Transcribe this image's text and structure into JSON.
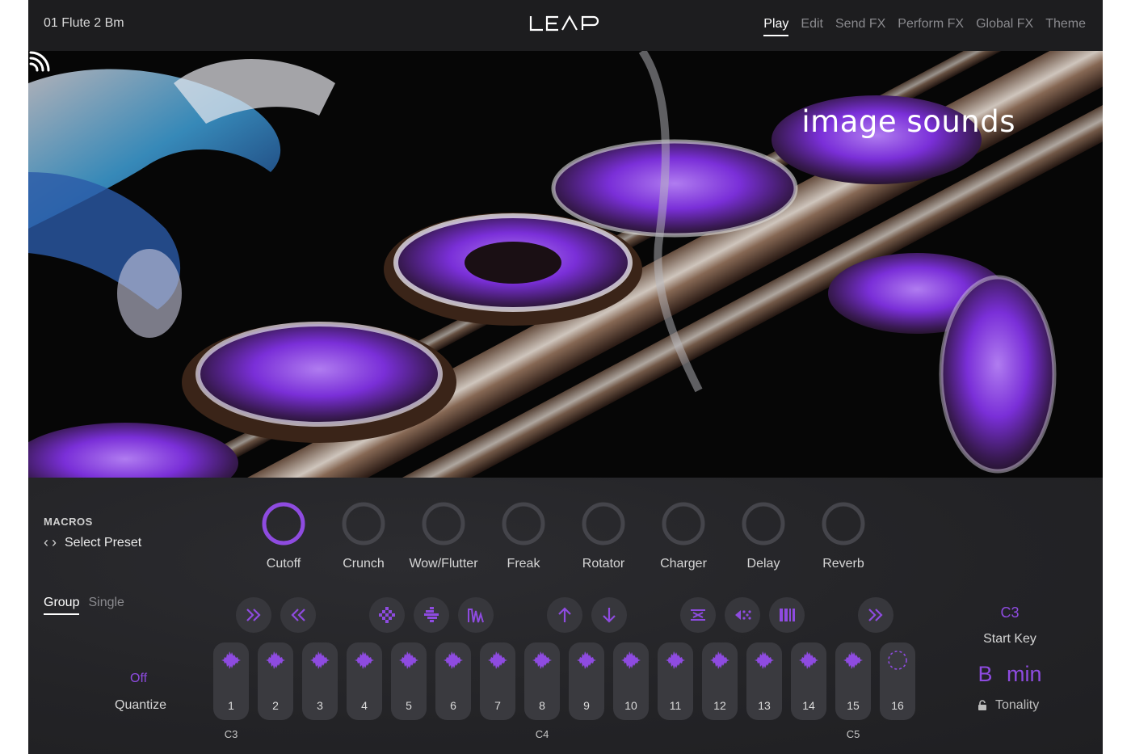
{
  "header": {
    "preset_name": "01 Flute 2 Bm",
    "logo": "LEAP",
    "tabs": [
      {
        "label": "Play",
        "active": true
      },
      {
        "label": "Edit",
        "active": false
      },
      {
        "label": "Send FX",
        "active": false
      },
      {
        "label": "Perform FX",
        "active": false
      },
      {
        "label": "Global FX",
        "active": false
      },
      {
        "label": "Theme",
        "active": false
      }
    ]
  },
  "hero": {
    "brand": "image sounds",
    "image_description_icon": "flute-artwork-image"
  },
  "macros": {
    "title": "MACROS",
    "preset_label": "Select Preset",
    "knobs": [
      {
        "label": "Cutoff",
        "value": 1.0
      },
      {
        "label": "Crunch",
        "value": 0.0
      },
      {
        "label": "Wow/Flutter",
        "value": 0.0
      },
      {
        "label": "Freak",
        "value": 0.0
      },
      {
        "label": "Rotator",
        "value": 0.0
      },
      {
        "label": "Charger",
        "value": 0.0
      },
      {
        "label": "Delay",
        "value": 0.0
      },
      {
        "label": "Reverb",
        "value": 0.0
      }
    ]
  },
  "mode_tabs": [
    {
      "label": "Group",
      "active": true
    },
    {
      "label": "Single",
      "active": false
    }
  ],
  "quantize": {
    "value": "Off",
    "label": "Quantize"
  },
  "fx_buttons": [
    {
      "icon": "fast-forward-icon"
    },
    {
      "icon": "rewind-icon"
    },
    {
      "icon": "stutter-icon"
    },
    {
      "icon": "glitch-icon"
    },
    {
      "icon": "envelope-icon"
    },
    {
      "icon": "pitch-up-icon"
    },
    {
      "icon": "pitch-down-icon"
    },
    {
      "icon": "reverse-icon"
    },
    {
      "icon": "scatter-icon"
    },
    {
      "icon": "slice-icon"
    },
    {
      "icon": "fast-forward-icon"
    }
  ],
  "pads": [
    "1",
    "2",
    "3",
    "4",
    "5",
    "6",
    "7",
    "8",
    "9",
    "10",
    "11",
    "12",
    "13",
    "14",
    "15",
    "16"
  ],
  "note_labels": [
    "C3",
    "C4",
    "C5"
  ],
  "start_key": {
    "value": "C3",
    "label": "Start Key"
  },
  "tonality": {
    "value": "B min",
    "label": "Tonality"
  },
  "colors": {
    "accent": "#8e4be0",
    "panel": "#232326",
    "topbar": "#1d1d1f",
    "pad": "#3a3a3f"
  }
}
